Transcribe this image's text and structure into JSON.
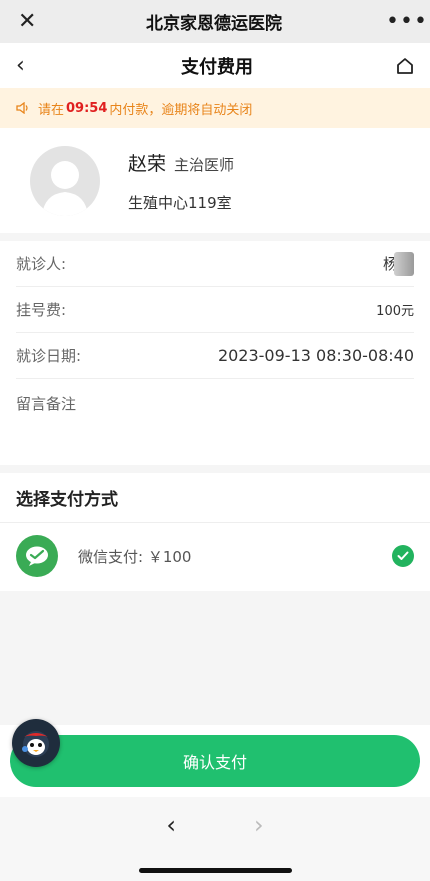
{
  "wechat_bar": {
    "title": "北京家恩德运医院",
    "close": "✕",
    "more": "•••"
  },
  "nav": {
    "back": "‹",
    "title": "支付费用"
  },
  "notice": {
    "prefix": "请在",
    "time": "09:54",
    "suffix": "内付款，逾期将自动关闭",
    "color": "#e8841a"
  },
  "doctor": {
    "name": "赵荣",
    "title": "主治医师",
    "department": "生殖中心119室"
  },
  "details": {
    "patient_label": "就诊人:",
    "patient_value": "杨",
    "fee_label": "挂号费:",
    "fee_value": "100元",
    "date_label": "就诊日期:",
    "date_value": "2023-09-13 08:30-08:40",
    "note_label": "留言备注"
  },
  "payment": {
    "heading": "选择支付方式",
    "method_label": "微信支付: ￥100",
    "accent": "#20c06f"
  },
  "confirm": {
    "label": "确认支付"
  },
  "browser_nav": {
    "back": "‹",
    "forward": "›"
  }
}
